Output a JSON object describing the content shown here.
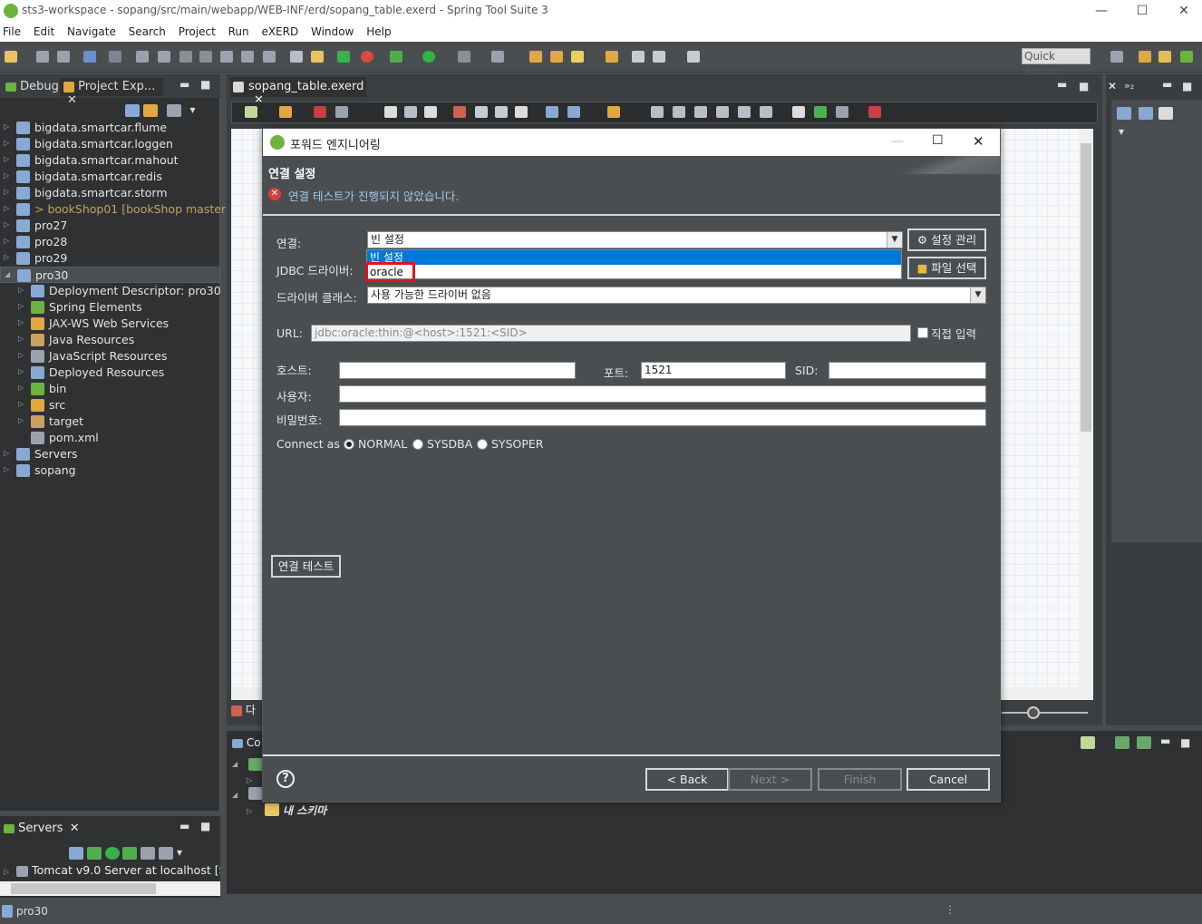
{
  "window": {
    "title": "sts3-workspace - sopang/src/main/webapp/WEB-INF/erd/sopang_table.exerd - Spring Tool Suite 3",
    "min": "—",
    "max": "☐",
    "close": "✕"
  },
  "menu": [
    "File",
    "Edit",
    "Navigate",
    "Search",
    "Project",
    "Run",
    "eXERD",
    "Window",
    "Help"
  ],
  "toolbar": {
    "quick_access": "Quick Access"
  },
  "left_panel": {
    "tab_debug": "Debug",
    "tab_project": "Project Exp...",
    "tree": [
      {
        "label": "bigdata.smartcar.flume",
        "level": 0
      },
      {
        "label": "bigdata.smartcar.loggen",
        "level": 0
      },
      {
        "label": "bigdata.smartcar.mahout",
        "level": 0
      },
      {
        "label": "bigdata.smartcar.redis",
        "level": 0
      },
      {
        "label": "bigdata.smartcar.storm",
        "level": 0
      },
      {
        "label": "> bookShop01",
        "suffix": "[bookShop master]",
        "level": 0
      },
      {
        "label": "pro27",
        "level": 0
      },
      {
        "label": "pro28",
        "level": 0
      },
      {
        "label": "pro29",
        "level": 0
      },
      {
        "label": "pro30",
        "level": 0,
        "expanded": true,
        "selected": true
      },
      {
        "label": "Deployment Descriptor: pro30",
        "level": 1
      },
      {
        "label": "Spring Elements",
        "level": 1
      },
      {
        "label": "JAX-WS Web Services",
        "level": 1
      },
      {
        "label": "Java Resources",
        "level": 1
      },
      {
        "label": "JavaScript Resources",
        "level": 1
      },
      {
        "label": "Deployed Resources",
        "level": 1
      },
      {
        "label": "bin",
        "level": 1
      },
      {
        "label": "src",
        "level": 1
      },
      {
        "label": "target",
        "level": 1
      },
      {
        "label": "pom.xml",
        "level": 1,
        "leaf": true
      },
      {
        "label": "Servers",
        "level": 0
      },
      {
        "label": "sopang",
        "level": 0
      }
    ]
  },
  "servers_panel": {
    "tab": "Servers",
    "row": "Tomcat v9.0 Server at localhost  [Sto"
  },
  "editor": {
    "tab": "sopang_table.exerd",
    "bottom_label_frag": "다",
    "console_label_frag": "Co",
    "bottom_tree_label": "내 스키마"
  },
  "dialog": {
    "title": "포워드 엔지니어링",
    "header_title": "연결 설정",
    "error_message": "연결 테스트가 진행되지 않았습니다.",
    "connection_label": "연결:",
    "connection_value": "빈 설정",
    "manage_button": "설정 관리",
    "dropdown_options": [
      "빈 설정",
      "oracle"
    ],
    "jdbc_label": "JDBC 드라이버:",
    "file_button": "파일 선택",
    "driver_class_label": "드라이버 클래스:",
    "driver_class_value": "사용 가능한 드라이버 없음",
    "url_label": "URL:",
    "url_value": "jdbc:oracle:thin:@<host>:1521:<SID>",
    "direct_input_label": "직접 입력",
    "host_label": "호스트:",
    "port_label": "포트:",
    "port_value": "1521",
    "sid_label": "SID:",
    "user_label": "사용자:",
    "password_label": "비밀번호:",
    "connect_as_label": "Connect as",
    "connect_as_options": [
      "NORMAL",
      "SYSDBA",
      "SYSOPER"
    ],
    "connect_as_selected": "NORMAL",
    "test_button": "연결 테스트",
    "help_icon": "?",
    "back_button": "< Back",
    "next_button": "Next >",
    "finish_button": "Finish",
    "cancel_button": "Cancel"
  },
  "status": {
    "left": "pro30"
  },
  "colors": {
    "accent": "#0078d7",
    "highlight": "#e0141e",
    "error": "#d9413a"
  }
}
